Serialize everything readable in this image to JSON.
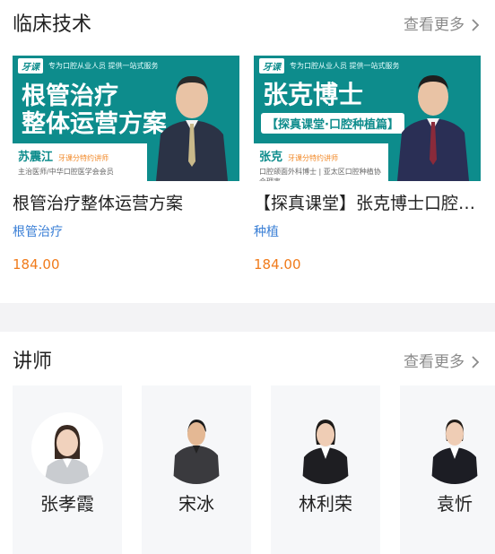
{
  "clinical": {
    "title": "临床技术",
    "see_more": "查看更多",
    "courses": [
      {
        "cover_logo": "牙课",
        "cover_slogan": "专为口腔从业人员 提供一站式服务",
        "cover_title_line1": "根管治疗",
        "cover_title_line2": "整体运营方案",
        "cover_name": "苏震江",
        "cover_name_tag": "牙课分特约讲师",
        "cover_name_desc": "主治医师/中华口腔医学会会员",
        "title": "根管治疗整体运营方案",
        "tag": "根管治疗",
        "price": "184.00"
      },
      {
        "cover_logo": "牙课",
        "cover_slogan": "专为口腔从业人员 提供一站式服务",
        "cover_title_line1": "张克博士",
        "cover_sub": "【探真课堂·口腔种植篇】",
        "cover_name": "张克",
        "cover_name_tag": "牙课分特约讲师",
        "cover_name_desc": "口腔颌面外科博士 | 亚太区口腔种植协会理事",
        "title": "【探真课堂】张克博士口腔种植篇",
        "tag": "种植",
        "price": "184.00"
      }
    ]
  },
  "lecturers": {
    "title": "讲师",
    "see_more": "查看更多",
    "items": [
      {
        "name": "张孝霞"
      },
      {
        "name": "宋冰"
      },
      {
        "name": "林利荣"
      },
      {
        "name": "袁忻"
      }
    ]
  },
  "colors": {
    "accent_teal": "#0d8c8c",
    "tag_blue": "#3a7fd6",
    "price_orange": "#f07b1b"
  }
}
